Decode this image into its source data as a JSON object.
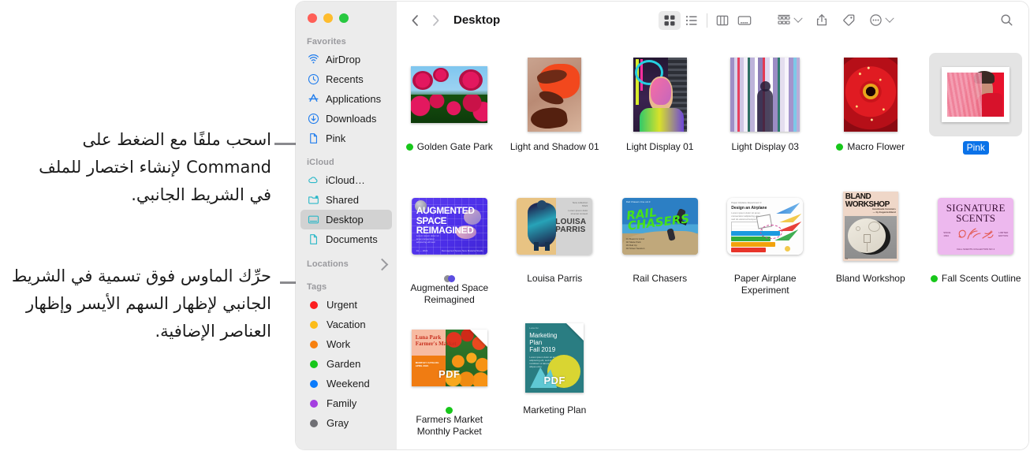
{
  "callouts": [
    {
      "id": "drag-file-callout",
      "text": "اسحب ملفًا مع الضغط على Command لإنشاء اختصار للملف في الشريط الجانبي."
    },
    {
      "id": "hover-label-callout",
      "text": "حرِّك الماوس فوق تسمية في الشريط الجانبي لإظهار السهم الأيسر وإظهار العناصر الإضافية."
    }
  ],
  "window": {
    "traffic_lights": [
      "close",
      "minimize",
      "zoom"
    ]
  },
  "toolbar": {
    "back_label": "‹",
    "forward_label": "›",
    "title": "Desktop",
    "view_buttons": [
      {
        "name": "icon-view",
        "selected": true
      },
      {
        "name": "list-view",
        "selected": false
      },
      {
        "name": "column-view",
        "selected": false
      },
      {
        "name": "gallery-view",
        "selected": false
      }
    ],
    "group_label": "group-by",
    "share_label": "share",
    "tags_label": "tags",
    "more_label": "more",
    "search_label": "search"
  },
  "sidebar": {
    "sections": [
      {
        "title": "Favorites",
        "items": [
          {
            "label": "AirDrop",
            "icon": "airdrop-icon",
            "color": "#1f7ced",
            "selected": false
          },
          {
            "label": "Recents",
            "icon": "clock-icon",
            "color": "#1f7ced",
            "selected": false
          },
          {
            "label": "Applications",
            "icon": "appstore-icon",
            "color": "#1f7ced",
            "selected": false
          },
          {
            "label": "Downloads",
            "icon": "download-icon",
            "color": "#1f7ced",
            "selected": false
          },
          {
            "label": "Pink",
            "icon": "document-icon",
            "color": "#1f7ced",
            "selected": false
          }
        ]
      },
      {
        "title": "iCloud",
        "items": [
          {
            "label": "iCloud…",
            "icon": "cloud-icon",
            "color": "#2bb8c8",
            "selected": false
          },
          {
            "label": "Shared",
            "icon": "shared-folder-icon",
            "color": "#2bb8c8",
            "selected": false
          },
          {
            "label": "Desktop",
            "icon": "desktop-icon",
            "color": "#2bb8c8",
            "selected": true
          },
          {
            "label": "Documents",
            "icon": "document-icon",
            "color": "#2bb8c8",
            "selected": false
          }
        ]
      },
      {
        "title": "Locations",
        "disclosure": "chevron-right-icon",
        "items": []
      },
      {
        "title": "Tags",
        "items": [
          {
            "label": "Urgent",
            "icon": "tag-dot",
            "color": "#fc1d20",
            "selected": false
          },
          {
            "label": "Vacation",
            "icon": "tag-dot",
            "color": "#fcbc19",
            "selected": false
          },
          {
            "label": "Work",
            "icon": "tag-dot",
            "color": "#f7800f",
            "selected": false
          },
          {
            "label": "Garden",
            "icon": "tag-dot",
            "color": "#17c71a",
            "selected": false
          },
          {
            "label": "Weekend",
            "icon": "tag-dot",
            "color": "#0a7bfc",
            "selected": false
          },
          {
            "label": "Family",
            "icon": "tag-dot",
            "color": "#a43fe0",
            "selected": false
          },
          {
            "label": "Gray",
            "icon": "tag-dot",
            "color": "#6f6f74",
            "selected": false
          }
        ]
      }
    ]
  },
  "files": [
    {
      "name": "Golden Gate Park",
      "art": "roses",
      "tags": [
        "#17c71a"
      ],
      "selected": false,
      "shape": "landscape"
    },
    {
      "name": "Light and Shadow 01",
      "art": "hands",
      "tags": [],
      "selected": false,
      "shape": "portrait"
    },
    {
      "name": "Light Display 01",
      "art": "neon-portrait",
      "tags": [],
      "selected": false,
      "shape": "portrait"
    },
    {
      "name": "Light Display 03",
      "art": "light-bars",
      "tags": [],
      "selected": false,
      "shape": "square"
    },
    {
      "name": "Macro Flower",
      "art": "macro-flower",
      "tags": [
        "#17c71a"
      ],
      "selected": false,
      "shape": "portrait"
    },
    {
      "name": "Pink",
      "art": "pink-portrait",
      "tags": [],
      "selected": true,
      "shape": "framed"
    },
    {
      "name": "Augmented Space Reimagined",
      "art": "augmented",
      "tags": [
        "#8e8e93",
        "#5b4de0"
      ],
      "selected": false,
      "shape": "landscape"
    },
    {
      "name": "Louisa Parris",
      "art": "louisa",
      "tags": [],
      "selected": false,
      "shape": "landscape"
    },
    {
      "name": "Rail Chasers",
      "art": "rail",
      "tags": [],
      "selected": false,
      "shape": "landscape"
    },
    {
      "name": "Paper Airplane Experiment",
      "art": "airplane",
      "tags": [],
      "selected": false,
      "shape": "landscape"
    },
    {
      "name": "Bland Workshop",
      "art": "bland",
      "tags": [],
      "selected": false,
      "shape": "portrait"
    },
    {
      "name": "Fall Scents Outline",
      "art": "scents",
      "tags": [
        "#17c71a"
      ],
      "selected": false,
      "shape": "landscape"
    },
    {
      "name": "Farmers Market Monthly Packet",
      "art": "farmers-pdf",
      "tags": [
        "#17c71a"
      ],
      "selected": false,
      "shape": "pdf-landscape"
    },
    {
      "name": "Marketing Plan",
      "art": "marketing-pdf",
      "tags": [],
      "selected": false,
      "shape": "pdf-portrait"
    }
  ]
}
